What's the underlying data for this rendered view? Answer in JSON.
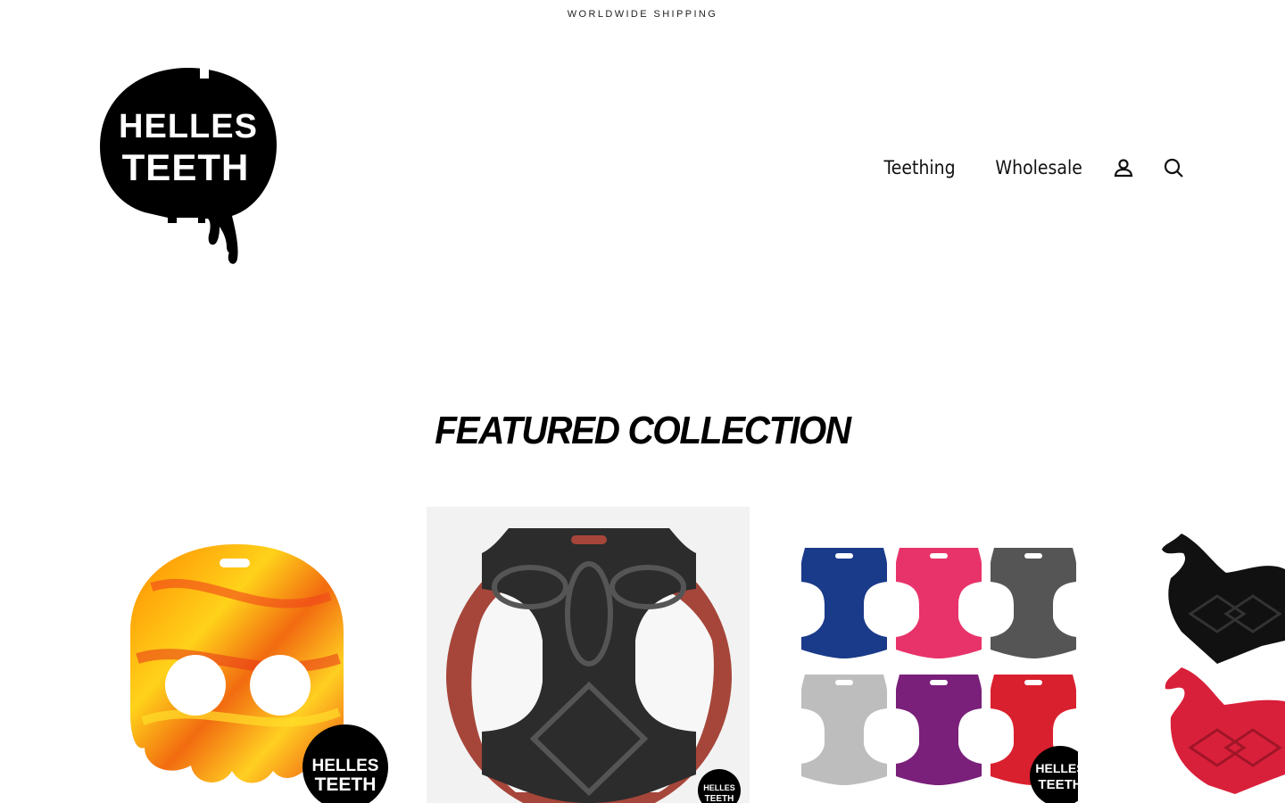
{
  "announcement": {
    "text": "WORLDWIDE SHIPPING"
  },
  "brand": {
    "logo_text_line1": "HELLES",
    "logo_text_line2": "TEETH"
  },
  "nav": {
    "items": [
      {
        "label": "Teething"
      },
      {
        "label": "Wholesale"
      }
    ],
    "account_icon": "person-icon",
    "search_icon": "search-icon"
  },
  "featured": {
    "title": "FEATURED COLLECTION"
  },
  "products": [
    {
      "image": "orange skull teether",
      "badge": "HELLES TEETH",
      "color": "#f07a10"
    },
    {
      "image": "black hammer teether",
      "badge": "HELLES TEETH",
      "color": "#2a2a2a"
    },
    {
      "image": "hammer teethers six colors",
      "badge": "HELLES TEETH",
      "colors": [
        "#1a3a8a",
        "#e8336a",
        "#555555",
        "#bdbdbd",
        "#7a1f7a",
        "#d9202e"
      ]
    },
    {
      "image": "horse teethers",
      "colors": [
        "#111111",
        "#d9203a"
      ]
    }
  ]
}
